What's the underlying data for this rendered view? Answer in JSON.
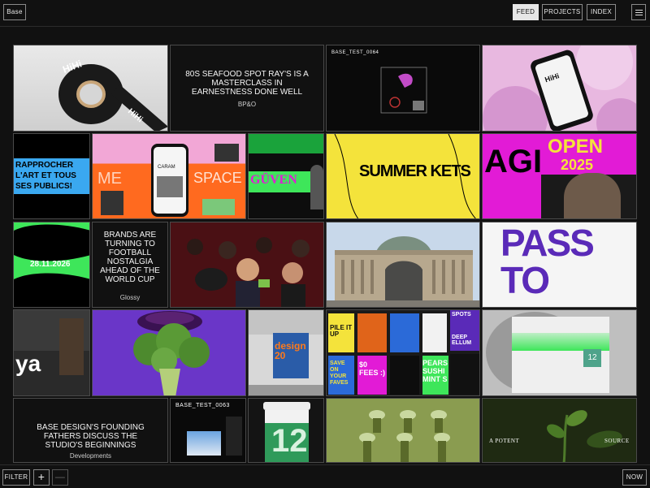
{
  "header": {
    "brand": "Base",
    "nav": [
      {
        "label": "FEED",
        "active": true
      },
      {
        "label": "PROJECTS",
        "active": false
      },
      {
        "label": "INDEX",
        "active": false
      }
    ],
    "menu_icon": "hamburger-icon"
  },
  "feed": {
    "article_1": {
      "title": "80S SEAFOOD SPOT RAY'S IS A MASTERCLASS IN EARNESTNESS DONE WELL",
      "byline": "BP&O"
    },
    "test_1": {
      "label": "BASE_TEST_0064"
    },
    "article_2": {
      "title": "BRANDS ARE TURNING TO FOOTBALL NOSTALGIA AHEAD OF THE WORLD CUP",
      "byline": "Glossy"
    },
    "article_3": {
      "title": "BASE DESIGN'S FOUNDING FATHERS DISCUSS THE STUDIO'S BEGINNINGS",
      "byline": "Developments"
    },
    "test_2": {
      "label": "BASE_TEST_0063"
    },
    "tape_text": "HiHi",
    "phone_brand": "HiHi",
    "rapprocher_text": "RAPPROCHER L'ART ET TOUS SES PUBLICS!",
    "phone_app_label": "CARAM",
    "space_text": "SPACE",
    "me_text": "ME",
    "guven_text": "GÜVEN",
    "summer_text": "SUMMER KETS",
    "agi_text": "AGI",
    "open_text": "OPEN",
    "year_text": "2025",
    "date_text": "28.11.2026",
    "pass_text": "PASS TO",
    "ya_text": "ya",
    "design_text": "design 20",
    "poster_texts": [
      "PILE IT UP",
      "$0 FEES :)",
      "PEARS SUSHI MINT S",
      "SAVE ON YOUR FAVES",
      "SPOTS",
      "DEEP ELLUM"
    ],
    "number_12": "12",
    "number_12_cup": "12",
    "potent_left": "A POTENT",
    "potent_right": "SOURCE"
  },
  "footer": {
    "filter": "FILTER",
    "zoom_in": "+",
    "zoom_out": "—",
    "now": "NOW"
  },
  "colors": {
    "background": "#111111",
    "yellow": "#f4e33b",
    "green": "#3ee65a",
    "purple": "#5a2ab8",
    "magenta": "#e21bd6",
    "pink": "#e8b8e0"
  }
}
